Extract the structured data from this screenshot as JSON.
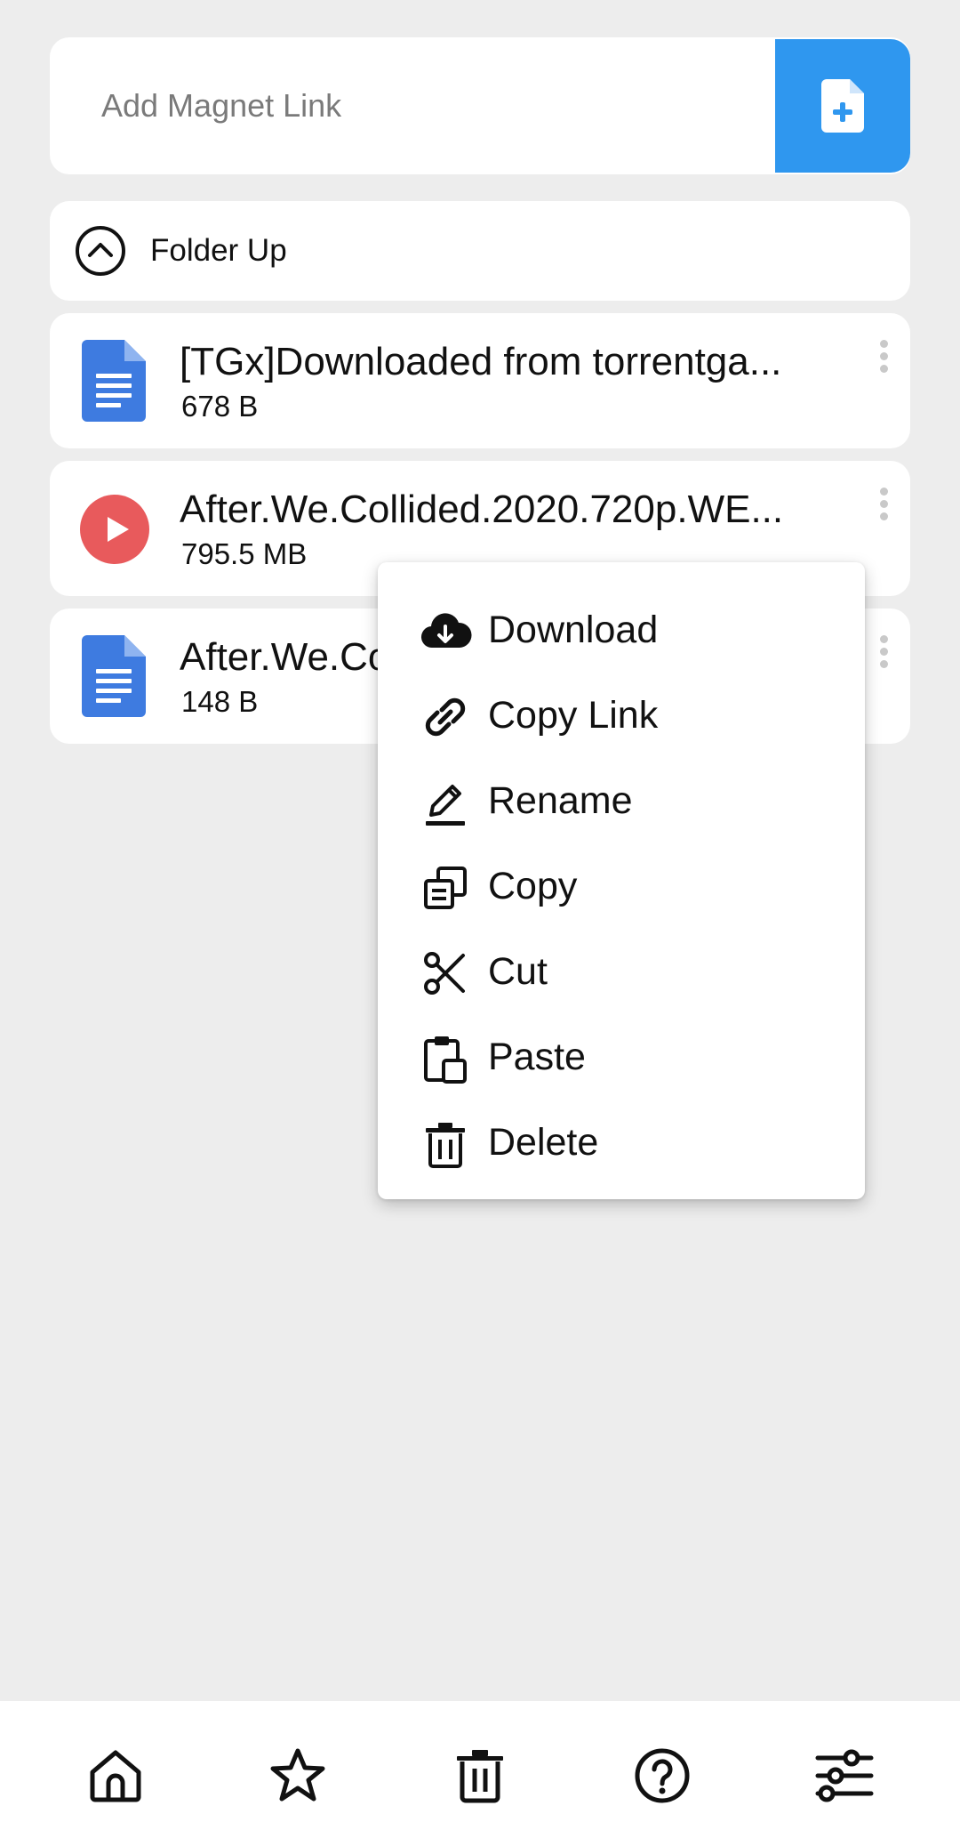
{
  "magnet": {
    "placeholder": "Add Magnet Link",
    "add_icon": "file-plus-icon",
    "accent": "#2f97ef"
  },
  "folder_up": {
    "label": "Folder Up",
    "icon": "chevron-up-circle-icon"
  },
  "files": [
    {
      "name": "[TGx]Downloaded from torrentga...",
      "size": "678 B",
      "type": "document",
      "icon": "document-icon"
    },
    {
      "name": "After.We.Collided.2020.720p.WE...",
      "size": "795.5 MB",
      "type": "video",
      "icon": "play-icon"
    },
    {
      "name": "After.We.Co",
      "size": "148 B",
      "type": "document",
      "icon": "document-icon"
    }
  ],
  "context_menu": {
    "items": [
      {
        "label": "Download",
        "icon": "cloud-download-icon"
      },
      {
        "label": "Copy Link",
        "icon": "link-icon"
      },
      {
        "label": "Rename",
        "icon": "pencil-icon"
      },
      {
        "label": "Copy",
        "icon": "copy-icon"
      },
      {
        "label": "Cut",
        "icon": "scissors-icon"
      },
      {
        "label": "Paste",
        "icon": "paste-icon"
      },
      {
        "label": "Delete",
        "icon": "trash-icon"
      }
    ]
  },
  "bottom_nav": {
    "items": [
      {
        "icon": "home-icon"
      },
      {
        "icon": "star-icon"
      },
      {
        "icon": "trash-icon"
      },
      {
        "icon": "help-icon"
      },
      {
        "icon": "settings-sliders-icon"
      }
    ]
  },
  "colors": {
    "document_blue": "#3e7be0",
    "video_red": "#e85a5c",
    "background": "#ededed"
  }
}
